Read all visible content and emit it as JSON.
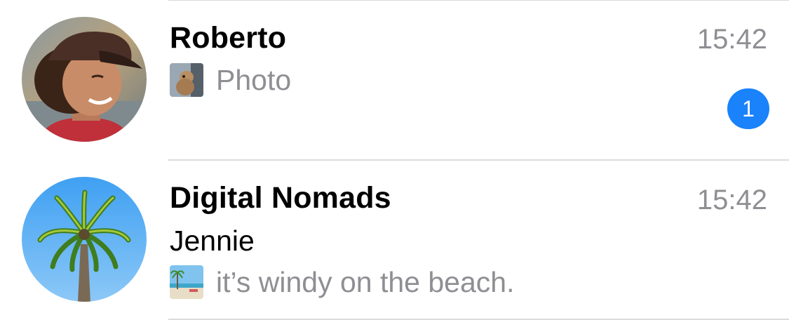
{
  "chats": [
    {
      "name": "Roberto",
      "time": "15:42",
      "preview_text": "Photo",
      "preview_icon": "photo-thumbnail",
      "unread_count": "1",
      "avatar": "person-avatar"
    },
    {
      "name": "Digital Nomads",
      "time": "15:42",
      "sender": "Jennie",
      "preview_text": "it’s windy on the beach.",
      "preview_icon": "beach-thumbnail",
      "avatar": "palm-tree-avatar"
    }
  ],
  "colors": {
    "badge": "#1a82fb",
    "secondary_text": "#8e8e93",
    "divider": "#dcdce0"
  }
}
